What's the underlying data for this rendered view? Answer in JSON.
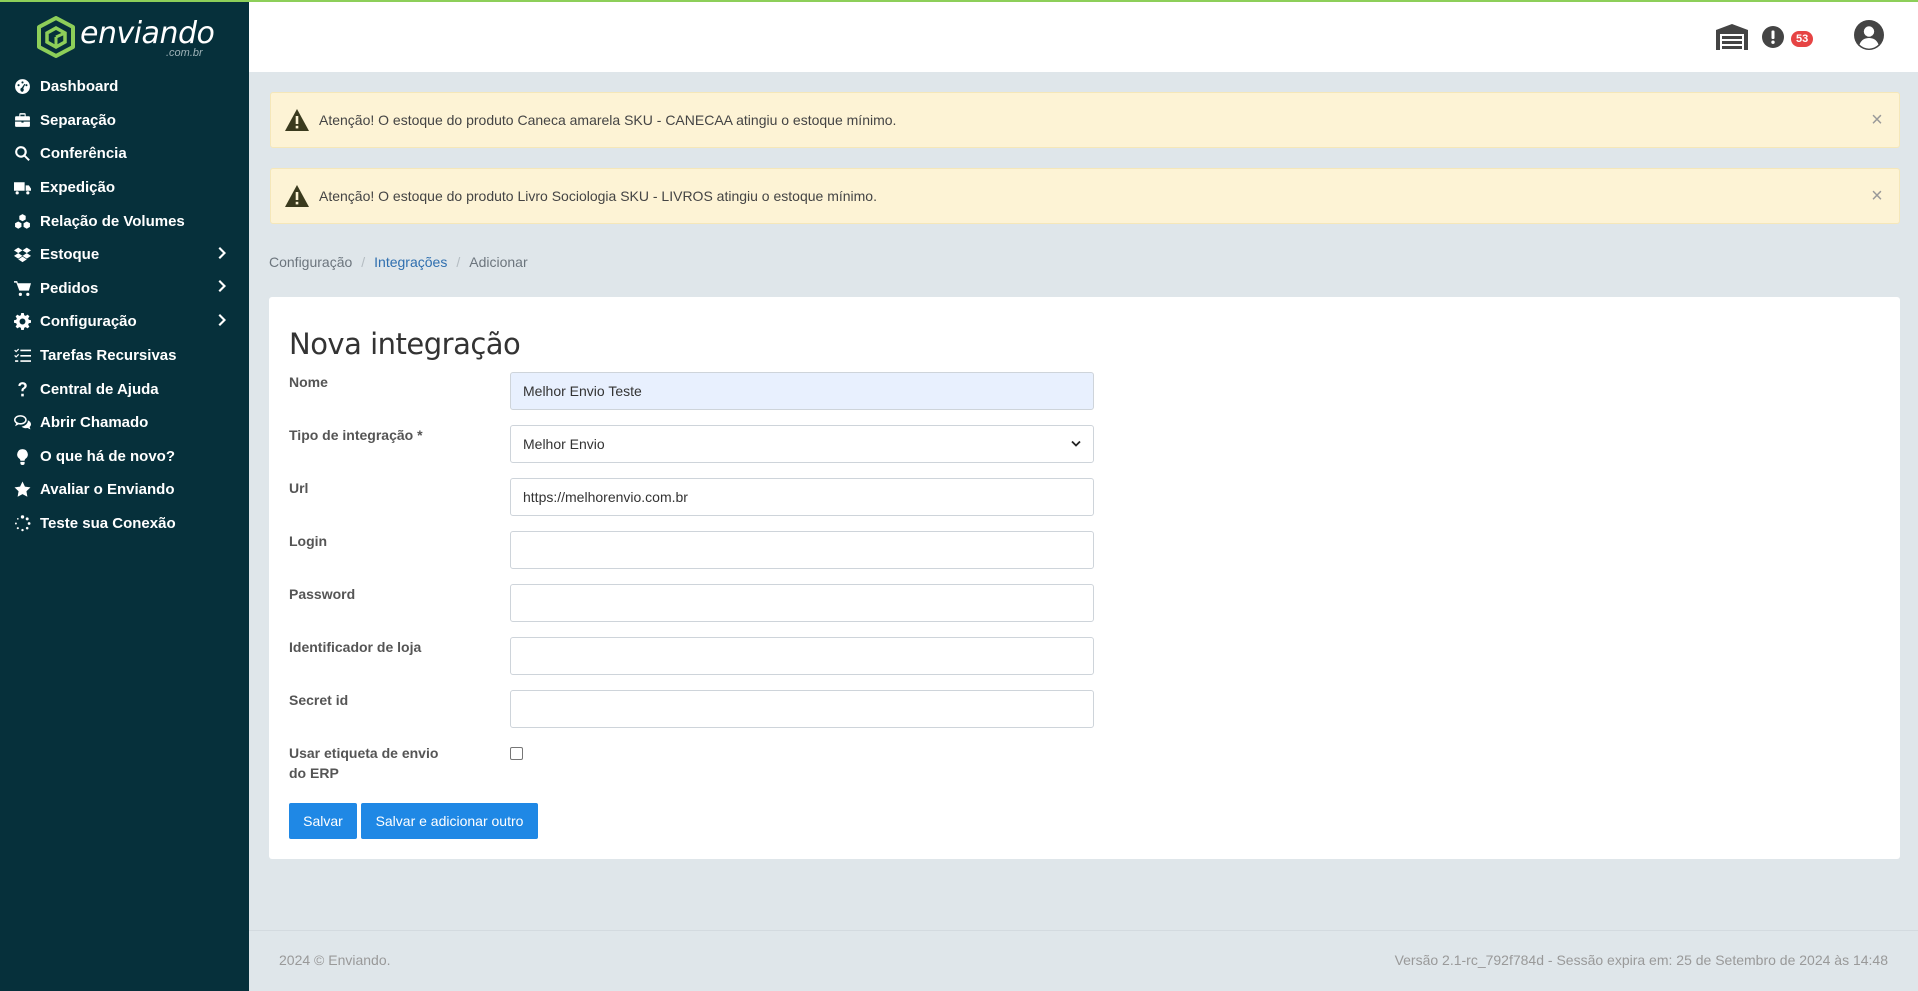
{
  "brand": {
    "name": "enviando",
    "sub": ".com.br",
    "color": "#8dcf59"
  },
  "sidebar": {
    "items": [
      {
        "label": "Dashboard",
        "icon": "dashboard-icon"
      },
      {
        "label": "Separação",
        "icon": "briefcase-icon"
      },
      {
        "label": "Conferência",
        "icon": "search-icon"
      },
      {
        "label": "Expedição",
        "icon": "truck-icon"
      },
      {
        "label": "Relação de Volumes",
        "icon": "boxes-icon"
      },
      {
        "label": "Estoque",
        "icon": "dropbox-icon",
        "has_submenu": true
      },
      {
        "label": "Pedidos",
        "icon": "cart-icon",
        "has_submenu": true
      },
      {
        "label": "Configuração",
        "icon": "gear-icon",
        "has_submenu": true
      },
      {
        "label": "Tarefas Recursivas",
        "icon": "tasks-icon"
      },
      {
        "label": "Central de Ajuda",
        "icon": "question-icon"
      },
      {
        "label": "Abrir Chamado",
        "icon": "chat-icon"
      },
      {
        "label": "O que há de novo?",
        "icon": "lightbulb-icon"
      },
      {
        "label": "Avaliar o Enviando",
        "icon": "star-icon"
      },
      {
        "label": "Teste sua Conexão",
        "icon": "spinner-icon"
      }
    ]
  },
  "header": {
    "notifications_count": "53"
  },
  "alerts": [
    {
      "message": "Atenção! O estoque do produto Caneca amarela SKU - CANECAA atingiu o estoque mínimo.",
      "close": "×"
    },
    {
      "message": "Atenção! O estoque do produto Livro Sociologia SKU - LIVROS atingiu o estoque mínimo.",
      "close": "×"
    }
  ],
  "breadcrumb": {
    "items": [
      "Configuração",
      "Integrações",
      "Adicionar"
    ],
    "sep": "/"
  },
  "form": {
    "title": "Nova integração",
    "fields": {
      "nome": {
        "label": "Nome",
        "value": "Melhor Envio Teste"
      },
      "tipo": {
        "label": "Tipo de integração *",
        "value": "Melhor Envio"
      },
      "url": {
        "label": "Url",
        "value": "https://melhorenvio.com.br"
      },
      "login": {
        "label": "Login",
        "value": ""
      },
      "password": {
        "label": "Password",
        "value": ""
      },
      "loja": {
        "label": "Identificador de loja",
        "value": ""
      },
      "secret": {
        "label": "Secret id",
        "value": ""
      },
      "etiqueta": {
        "label": "Usar etiqueta de envio do ERP",
        "checked": false
      }
    },
    "buttons": {
      "save": "Salvar",
      "save_add": "Salvar e adicionar outro"
    }
  },
  "footer": {
    "left": "2024 © Enviando.",
    "right": "Versão 2.1-rc_792f784d - Sessão expira em: 25 de Setembro de 2024 às 14:48"
  }
}
